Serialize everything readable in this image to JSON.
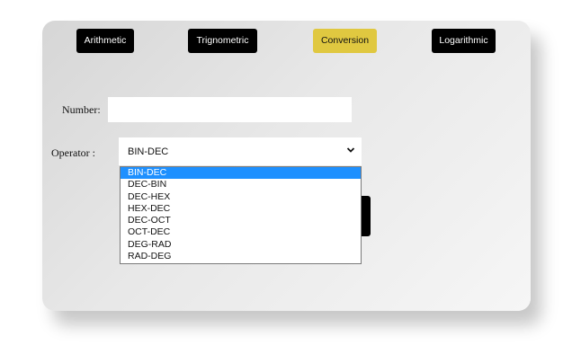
{
  "tabs": [
    {
      "label": "Arithmetic",
      "active": false
    },
    {
      "label": "Trignometric",
      "active": false
    },
    {
      "label": "Conversion",
      "active": true
    },
    {
      "label": "Logarithmic",
      "active": false
    }
  ],
  "form": {
    "number_label": "Number:",
    "number_value": "",
    "operator_label": "Operator :",
    "operator_selected": "BIN-DEC",
    "operator_options": [
      "BIN-DEC",
      "DEC-BIN",
      "DEC-HEX",
      "HEX-DEC",
      "DEC-OCT",
      "OCT-DEC",
      "DEG-RAD",
      "RAD-DEG"
    ]
  },
  "colors": {
    "active_tab": "#e0c840",
    "tab": "#000000",
    "highlight": "#1e90ff"
  }
}
